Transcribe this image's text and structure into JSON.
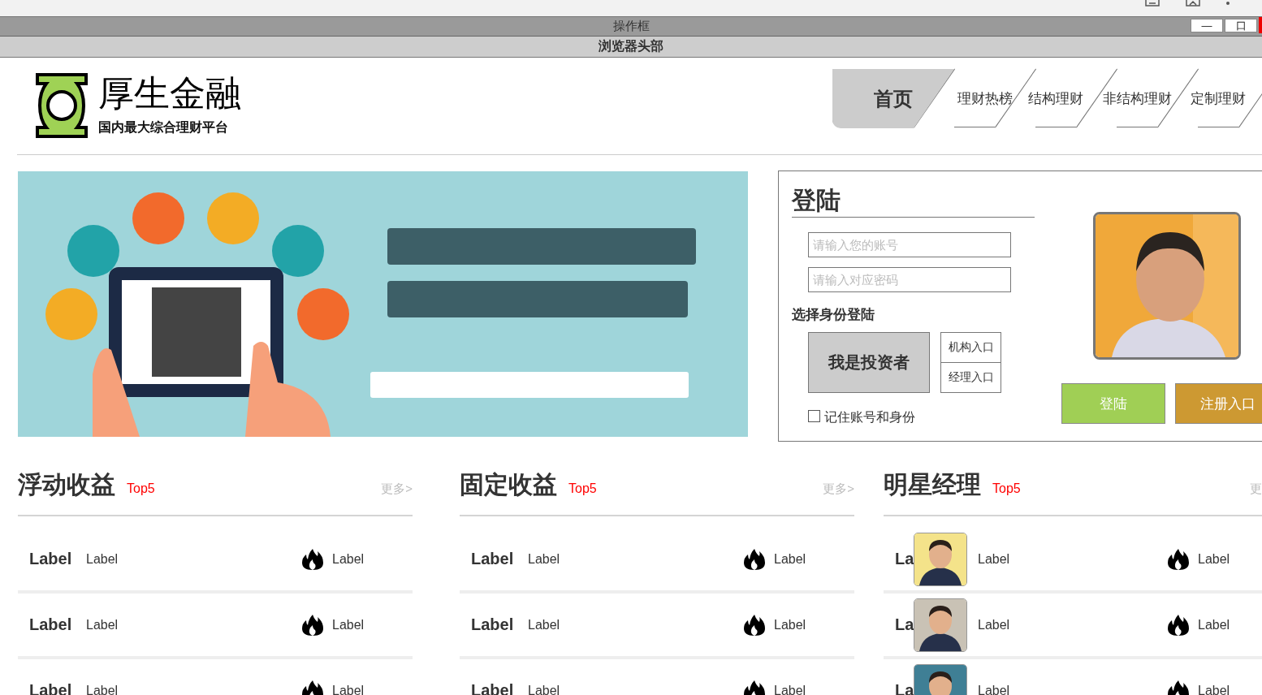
{
  "frame_bar": {
    "title": "操作框",
    "buttons": [
      "—",
      "口"
    ]
  },
  "browser_header": {
    "title": "浏览器头部"
  },
  "logo": {
    "name": "厚生金融",
    "tagline": "国内最大综合理财平台"
  },
  "nav": [
    {
      "label": "首页",
      "selected": true
    },
    {
      "label": "理财热榜",
      "selected": false
    },
    {
      "label": "结构理财",
      "selected": false
    },
    {
      "label": "非结构理财",
      "selected": false
    },
    {
      "label": "定制理财",
      "selected": false
    }
  ],
  "login": {
    "title": "登陆",
    "fields": [
      {
        "placeholder": "请输入您的账号"
      },
      {
        "placeholder": "请输入对应密码"
      }
    ],
    "role_heading": "选择身份登陆",
    "roles": [
      {
        "label": "我是投资者",
        "selected": true
      },
      {
        "label": "机构入口",
        "selected": false
      },
      {
        "label": "经理入口",
        "selected": false
      }
    ],
    "remember": {
      "label": "记住账号和身份",
      "checked": false
    },
    "buttons": [
      {
        "label": "登陆",
        "kind": "primary"
      },
      {
        "label": "注册入口",
        "kind": "register"
      }
    ]
  },
  "sections": [
    {
      "title": "浮动收益",
      "badge": "Top5",
      "more": "更多>",
      "rows": [
        {
          "name": "Label",
          "label": "Label",
          "hot": "Label"
        },
        {
          "name": "Label",
          "label": "Label",
          "hot": "Label"
        },
        {
          "name": "Label",
          "label": "Label",
          "hot": "Label"
        }
      ]
    },
    {
      "title": "固定收益",
      "badge": "Top5",
      "more": "更多>",
      "rows": [
        {
          "name": "Label",
          "label": "Label",
          "hot": "Label"
        },
        {
          "name": "Label",
          "label": "Label",
          "hot": "Label"
        },
        {
          "name": "Label",
          "label": "Label",
          "hot": "Label"
        }
      ]
    },
    {
      "title": "明星经理",
      "badge": "Top5",
      "more": "更",
      "rows": [
        {
          "kind": "manager",
          "name": "La",
          "label": "Label",
          "hot": "Label"
        },
        {
          "kind": "manager",
          "name": "La",
          "label": "Label",
          "hot": "Label"
        },
        {
          "kind": "manager",
          "name": "La",
          "label": "Label",
          "hot": "Label"
        }
      ]
    }
  ]
}
